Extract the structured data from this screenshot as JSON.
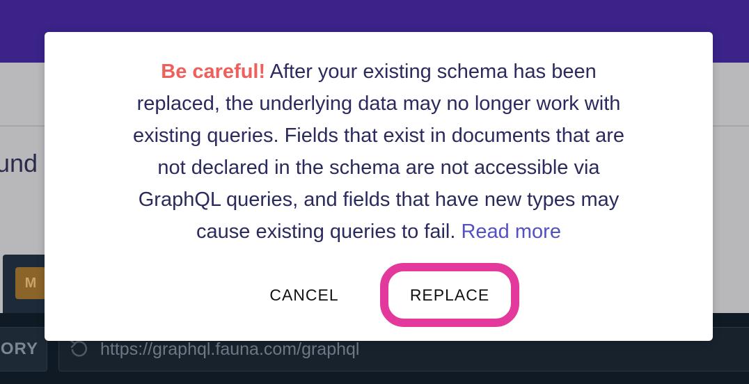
{
  "background": {
    "heading_fragment": "und",
    "tab_badge": "M",
    "history_label": "ORY",
    "url_icon": "undo-icon",
    "url": "https://graphql.fauna.com/graphql"
  },
  "dialog": {
    "warning": "Be careful!",
    "message": "After your existing schema has been replaced, the underlying data may no longer work with existing queries. Fields that exist in documents that are not declared in the schema are not accessible via GraphQL queries, and fields that have new types may cause existing queries to fail.",
    "link": "Read more",
    "cancel_label": "CANCEL",
    "replace_label": "REPLACE"
  },
  "colors": {
    "topbar": "#3b2389",
    "warning": "#ef5f5b",
    "link": "#5250c2",
    "highlight": "#e3399c",
    "text": "#2b2a5e"
  }
}
